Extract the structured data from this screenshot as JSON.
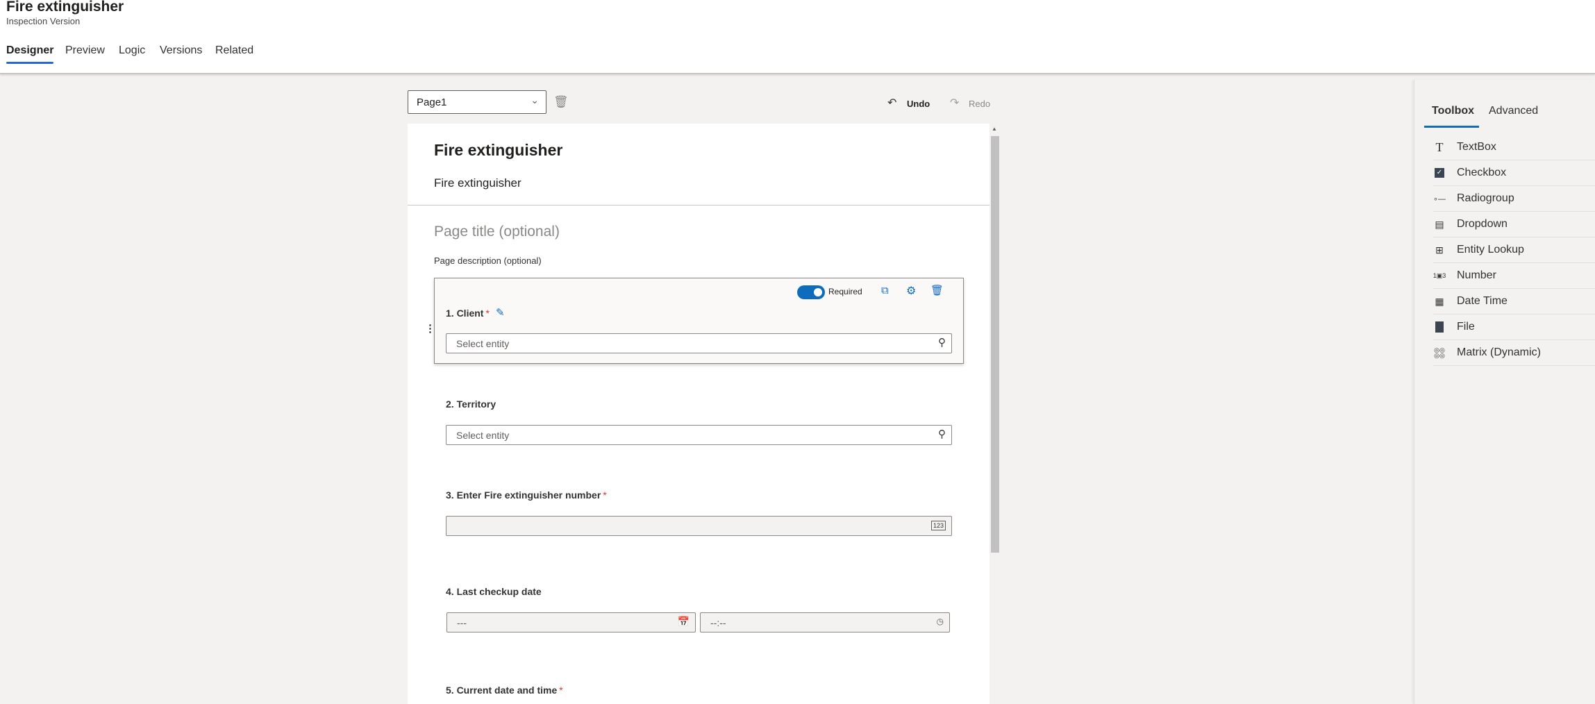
{
  "header": {
    "title": "Fire extinguisher",
    "subtitle": "Inspection Version",
    "tabs": [
      {
        "label": "Designer",
        "active": true
      },
      {
        "label": "Preview"
      },
      {
        "label": "Logic"
      },
      {
        "label": "Versions"
      },
      {
        "label": "Related"
      }
    ]
  },
  "toolbar": {
    "page_select": "Page1",
    "undo": "Undo",
    "redo": "Redo"
  },
  "form": {
    "title": "Fire extinguisher",
    "description": "Fire extinguisher",
    "page_title_placeholder": "Page title (optional)",
    "page_description_placeholder": "Page description (optional)",
    "required_label": "Required",
    "required_on": true,
    "questions": [
      {
        "label": "1.  Client",
        "required": "*",
        "placeholder": "Select entity"
      },
      {
        "label": "2.  Territory",
        "placeholder": "Select entity"
      },
      {
        "label": "3.  Enter Fire extinguisher number",
        "required": "*",
        "icon_text": "123"
      },
      {
        "label": "4.  Last checkup date",
        "date_placeholder": "---",
        "time_placeholder": "--:--"
      },
      {
        "label": "5.  Current date and time",
        "required": "*"
      }
    ]
  },
  "panel": {
    "tabs": [
      {
        "label": "Toolbox",
        "active": true
      },
      {
        "label": "Advanced"
      }
    ],
    "items": [
      {
        "label": "TextBox",
        "icon": "text-icon"
      },
      {
        "label": "Checkbox",
        "icon": "checkbox-icon"
      },
      {
        "label": "Radiogroup",
        "icon": "radiogroup-icon"
      },
      {
        "label": "Dropdown",
        "icon": "dropdown-icon"
      },
      {
        "label": "Entity Lookup",
        "icon": "entity-lookup-icon"
      },
      {
        "label": "Number",
        "icon": "number-icon"
      },
      {
        "label": "Date Time",
        "icon": "calendar-icon"
      },
      {
        "label": "File",
        "icon": "file-icon"
      },
      {
        "label": "Matrix (Dynamic)",
        "icon": "matrix-icon"
      }
    ]
  },
  "colors": {
    "accent": "#0f6cbd",
    "tab_underline": "#2266e3",
    "required": "#d13438"
  }
}
